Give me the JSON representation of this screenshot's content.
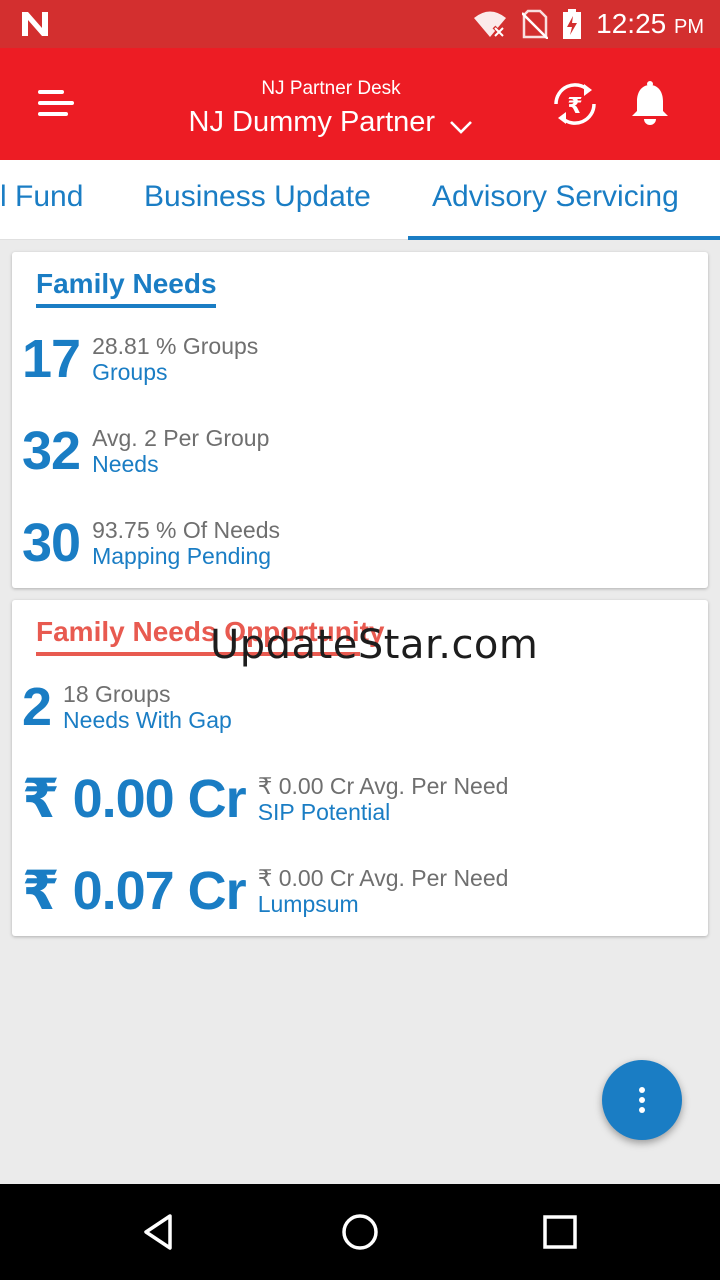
{
  "status_bar": {
    "time": "12:25",
    "ampm": "PM",
    "icons": [
      "notification-n-icon",
      "wifi-off-icon",
      "no-sim-icon",
      "battery-charging-icon"
    ]
  },
  "app_bar": {
    "subtitle": "NJ Partner Desk",
    "title": "NJ Dummy Partner",
    "icons": [
      "menu-icon",
      "chevron-down-icon",
      "rupee-refresh-icon",
      "bell-icon"
    ]
  },
  "tabs": [
    {
      "label": "l Fund"
    },
    {
      "label": "Business Update"
    },
    {
      "label": "Advisory Servicing",
      "selected": true
    }
  ],
  "family_needs": {
    "title": "Family Needs",
    "accent": "#1a7dc4",
    "rows": [
      {
        "value": "17",
        "detail": "28.81 % Groups",
        "label": "Groups"
      },
      {
        "value": "32",
        "detail": "Avg. 2 Per Group",
        "label": "Needs"
      },
      {
        "value": "30",
        "detail": "93.75 % Of Needs",
        "label": "Mapping Pending"
      }
    ]
  },
  "family_needs_opportunity": {
    "title": "Family Needs Opportunity",
    "accent": "#e85a50",
    "rows": [
      {
        "value": "2",
        "detail": "18 Groups",
        "label": "Needs With Gap"
      },
      {
        "value": "₹ 0.00 Cr",
        "detail": "₹ 0.00 Cr Avg. Per Need",
        "label": "SIP Potential"
      },
      {
        "value": "₹ 0.07 Cr",
        "detail": "₹ 0.00 Cr Avg. Per Need",
        "label": "Lumpsum"
      }
    ]
  },
  "watermark": "UpdateStar.com",
  "fab": {
    "icon": "more-vertical-icon"
  },
  "nav_bar": {
    "icons": [
      "back-icon",
      "home-icon",
      "recents-icon"
    ]
  },
  "colors": {
    "status_bar": "#d32f2f",
    "app_bar": "#ed1c24",
    "primary_blue": "#1a7dc4"
  }
}
